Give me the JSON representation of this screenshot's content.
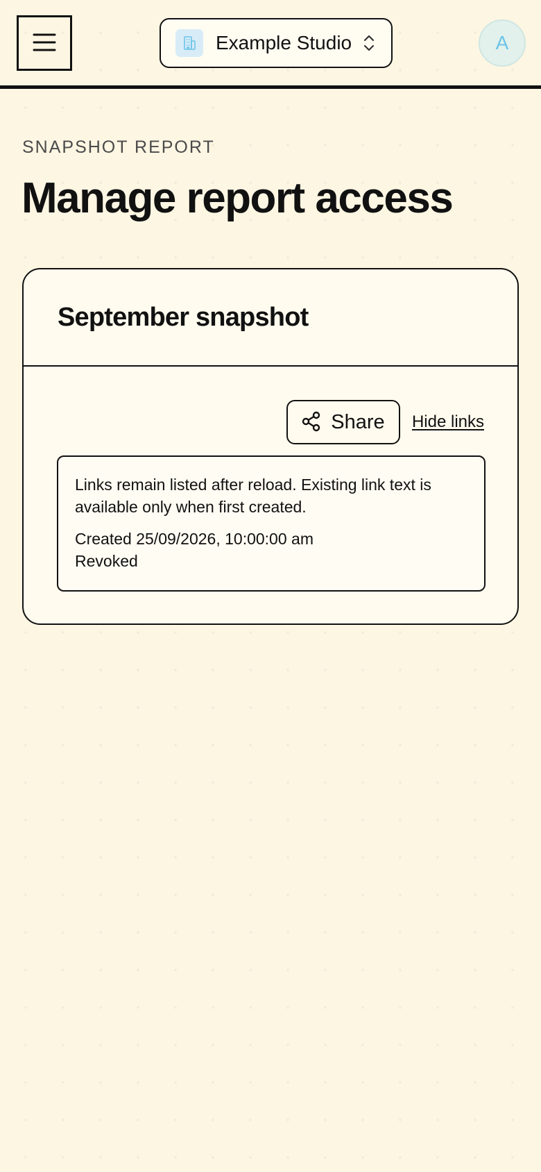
{
  "header": {
    "workspace": {
      "name": "Example Studio",
      "logo_icon": "building-icon",
      "logo_color": "#6cc4e8"
    },
    "avatar": {
      "initial": "A",
      "color": "#6cc4e8"
    }
  },
  "page": {
    "eyebrow": "SNAPSHOT REPORT",
    "title": "Manage report access"
  },
  "card": {
    "title": "September snapshot",
    "share_label": "Share",
    "hide_links_label": "Hide links",
    "links": {
      "notice": "Links remain listed after reload. Existing link text is available only when first created.",
      "created": "Created 25/09/2026, 10:00:00 am",
      "status": "Revoked"
    }
  },
  "colors": {
    "background": "#fdf6e3",
    "ink": "#111111",
    "accent": "#6cc4e8"
  }
}
